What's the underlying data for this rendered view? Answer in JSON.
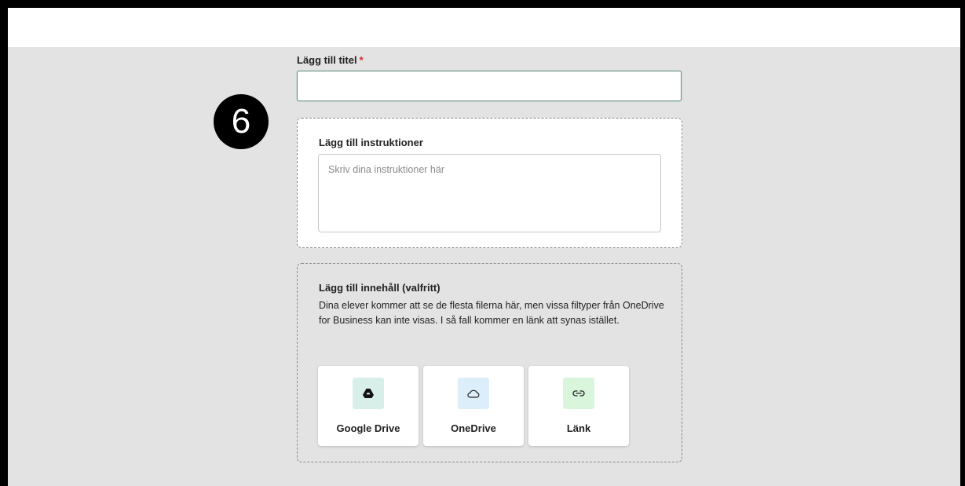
{
  "step_badge": "6",
  "title_field": {
    "label": "Lägg till titel",
    "required_marker": "*",
    "value": ""
  },
  "instructions": {
    "heading": "Lägg till instruktioner",
    "placeholder": "Skriv dina instruktioner här"
  },
  "content": {
    "heading": "Lägg till innehåll (valfritt)",
    "description": "Dina elever kommer att se de flesta filerna här, men vissa filtyper från OneDrive for Business kan inte visas. I så fall kommer en länk att synas istället.",
    "sources": [
      {
        "label": "Google Drive",
        "icon": "google-drive-icon",
        "tint": "#d8efe9"
      },
      {
        "label": "OneDrive",
        "icon": "cloud-icon",
        "tint": "#dbeefa"
      },
      {
        "label": "Länk",
        "icon": "link-icon",
        "tint": "#d9f5dc"
      }
    ]
  },
  "colors": {
    "required": "#d62929",
    "page_bg": "#e3e3e3",
    "input_border": "#6f8f86"
  }
}
